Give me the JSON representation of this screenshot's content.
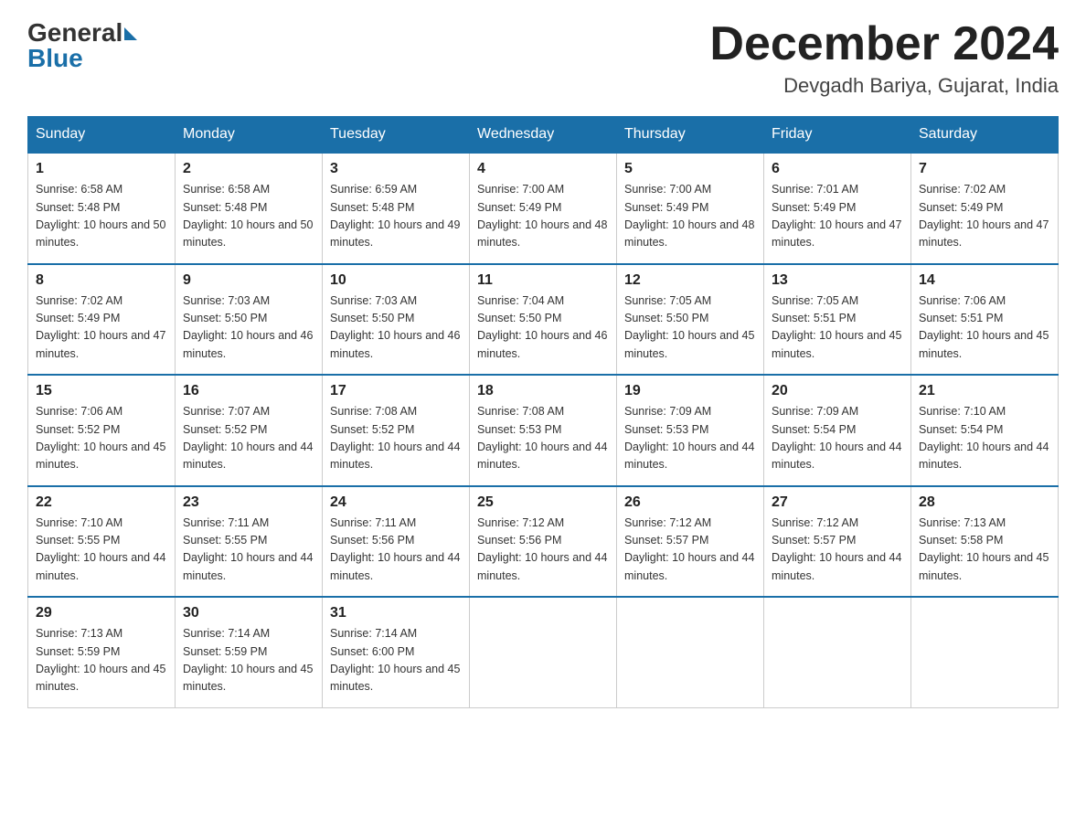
{
  "header": {
    "logo_general": "General",
    "logo_blue": "Blue",
    "month_title": "December 2024",
    "location": "Devgadh Bariya, Gujarat, India"
  },
  "weekdays": [
    "Sunday",
    "Monday",
    "Tuesday",
    "Wednesday",
    "Thursday",
    "Friday",
    "Saturday"
  ],
  "weeks": [
    [
      {
        "day": "1",
        "sunrise": "6:58 AM",
        "sunset": "5:48 PM",
        "daylight": "10 hours and 50 minutes."
      },
      {
        "day": "2",
        "sunrise": "6:58 AM",
        "sunset": "5:48 PM",
        "daylight": "10 hours and 50 minutes."
      },
      {
        "day": "3",
        "sunrise": "6:59 AM",
        "sunset": "5:48 PM",
        "daylight": "10 hours and 49 minutes."
      },
      {
        "day": "4",
        "sunrise": "7:00 AM",
        "sunset": "5:49 PM",
        "daylight": "10 hours and 48 minutes."
      },
      {
        "day": "5",
        "sunrise": "7:00 AM",
        "sunset": "5:49 PM",
        "daylight": "10 hours and 48 minutes."
      },
      {
        "day": "6",
        "sunrise": "7:01 AM",
        "sunset": "5:49 PM",
        "daylight": "10 hours and 47 minutes."
      },
      {
        "day": "7",
        "sunrise": "7:02 AM",
        "sunset": "5:49 PM",
        "daylight": "10 hours and 47 minutes."
      }
    ],
    [
      {
        "day": "8",
        "sunrise": "7:02 AM",
        "sunset": "5:49 PM",
        "daylight": "10 hours and 47 minutes."
      },
      {
        "day": "9",
        "sunrise": "7:03 AM",
        "sunset": "5:50 PM",
        "daylight": "10 hours and 46 minutes."
      },
      {
        "day": "10",
        "sunrise": "7:03 AM",
        "sunset": "5:50 PM",
        "daylight": "10 hours and 46 minutes."
      },
      {
        "day": "11",
        "sunrise": "7:04 AM",
        "sunset": "5:50 PM",
        "daylight": "10 hours and 46 minutes."
      },
      {
        "day": "12",
        "sunrise": "7:05 AM",
        "sunset": "5:50 PM",
        "daylight": "10 hours and 45 minutes."
      },
      {
        "day": "13",
        "sunrise": "7:05 AM",
        "sunset": "5:51 PM",
        "daylight": "10 hours and 45 minutes."
      },
      {
        "day": "14",
        "sunrise": "7:06 AM",
        "sunset": "5:51 PM",
        "daylight": "10 hours and 45 minutes."
      }
    ],
    [
      {
        "day": "15",
        "sunrise": "7:06 AM",
        "sunset": "5:52 PM",
        "daylight": "10 hours and 45 minutes."
      },
      {
        "day": "16",
        "sunrise": "7:07 AM",
        "sunset": "5:52 PM",
        "daylight": "10 hours and 44 minutes."
      },
      {
        "day": "17",
        "sunrise": "7:08 AM",
        "sunset": "5:52 PM",
        "daylight": "10 hours and 44 minutes."
      },
      {
        "day": "18",
        "sunrise": "7:08 AM",
        "sunset": "5:53 PM",
        "daylight": "10 hours and 44 minutes."
      },
      {
        "day": "19",
        "sunrise": "7:09 AM",
        "sunset": "5:53 PM",
        "daylight": "10 hours and 44 minutes."
      },
      {
        "day": "20",
        "sunrise": "7:09 AM",
        "sunset": "5:54 PM",
        "daylight": "10 hours and 44 minutes."
      },
      {
        "day": "21",
        "sunrise": "7:10 AM",
        "sunset": "5:54 PM",
        "daylight": "10 hours and 44 minutes."
      }
    ],
    [
      {
        "day": "22",
        "sunrise": "7:10 AM",
        "sunset": "5:55 PM",
        "daylight": "10 hours and 44 minutes."
      },
      {
        "day": "23",
        "sunrise": "7:11 AM",
        "sunset": "5:55 PM",
        "daylight": "10 hours and 44 minutes."
      },
      {
        "day": "24",
        "sunrise": "7:11 AM",
        "sunset": "5:56 PM",
        "daylight": "10 hours and 44 minutes."
      },
      {
        "day": "25",
        "sunrise": "7:12 AM",
        "sunset": "5:56 PM",
        "daylight": "10 hours and 44 minutes."
      },
      {
        "day": "26",
        "sunrise": "7:12 AM",
        "sunset": "5:57 PM",
        "daylight": "10 hours and 44 minutes."
      },
      {
        "day": "27",
        "sunrise": "7:12 AM",
        "sunset": "5:57 PM",
        "daylight": "10 hours and 44 minutes."
      },
      {
        "day": "28",
        "sunrise": "7:13 AM",
        "sunset": "5:58 PM",
        "daylight": "10 hours and 45 minutes."
      }
    ],
    [
      {
        "day": "29",
        "sunrise": "7:13 AM",
        "sunset": "5:59 PM",
        "daylight": "10 hours and 45 minutes."
      },
      {
        "day": "30",
        "sunrise": "7:14 AM",
        "sunset": "5:59 PM",
        "daylight": "10 hours and 45 minutes."
      },
      {
        "day": "31",
        "sunrise": "7:14 AM",
        "sunset": "6:00 PM",
        "daylight": "10 hours and 45 minutes."
      },
      null,
      null,
      null,
      null
    ]
  ]
}
